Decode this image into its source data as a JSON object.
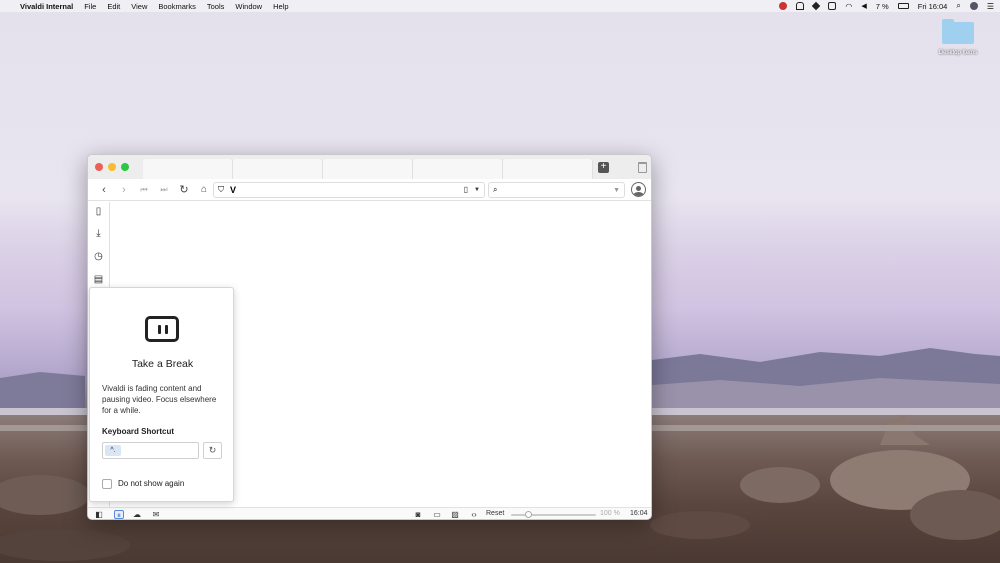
{
  "menubar": {
    "app_name": "Vivaldi Internal",
    "items": [
      "File",
      "Edit",
      "View",
      "Bookmarks",
      "Tools",
      "Window",
      "Help"
    ],
    "battery": "7 %",
    "clock": "Fri 16:04"
  },
  "desktop": {
    "item_label": "Desktop Items"
  },
  "browser": {
    "address_text": "V",
    "tabs": 5
  },
  "popup": {
    "title": "Take a Break",
    "description": "Vivaldi is fading content and pausing video. Focus elsewhere for a while.",
    "shortcut_label": "Keyboard Shortcut",
    "shortcut_key": "^.",
    "checkbox_label": "Do not show again"
  },
  "statusbar": {
    "reset_label": "Reset",
    "zoom": "100 %",
    "zoom_level": 0.2,
    "time": "16:04"
  }
}
